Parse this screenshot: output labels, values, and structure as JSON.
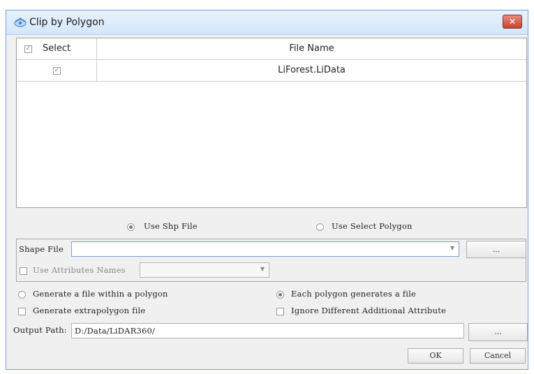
{
  "window": {
    "title": "Clip by Polygon",
    "close_label": "✕"
  },
  "table": {
    "header_select": "Select",
    "header_filename": "File Name",
    "rows": [
      {
        "checked": true,
        "file_name": "LiForest.LiData"
      }
    ]
  },
  "source_options": {
    "use_shp": "Use Shp File",
    "use_select_polygon": "Use Select Polygon",
    "selected": "use_shp"
  },
  "shape_file": {
    "label": "Shape File",
    "value": "",
    "browse_label": "...",
    "use_attr_label": "Use Attributes Names",
    "attr_value": ""
  },
  "options": {
    "generate_within": "Generate a file within a polygon",
    "each_polygon": "Each polygon generates a file",
    "generate_extra": "Generate extrapolygon file",
    "ignore_attr": "Ignore Different Additional Attribute",
    "selected_mode": "each_polygon"
  },
  "output": {
    "label": "Output Path:",
    "value": "D:/Data/LiDAR360/",
    "browse_label": "..."
  },
  "buttons": {
    "ok": "OK",
    "cancel": "Cancel"
  },
  "colors": {
    "title_bar": "#d4e6fb",
    "close_button": "#c4452e",
    "dialog_bg": "#f0f0f0"
  }
}
